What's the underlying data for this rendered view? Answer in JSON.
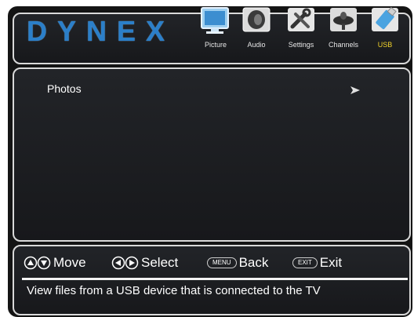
{
  "brand": "DYNEX",
  "menu": [
    {
      "label": "Picture",
      "icon": "tv-monitor-icon",
      "active": false
    },
    {
      "label": "Audio",
      "icon": "speaker-icon",
      "active": false
    },
    {
      "label": "Settings",
      "icon": "tools-icon",
      "active": false
    },
    {
      "label": "Channels",
      "icon": "satellite-dish-icon",
      "active": false
    },
    {
      "label": "USB",
      "icon": "usb-drive-icon",
      "active": true
    }
  ],
  "content": {
    "items": [
      {
        "label": "Photos",
        "icon": "arrow-right-icon"
      }
    ]
  },
  "hints": {
    "move": "Move",
    "select": "Select",
    "menu_key": "MENU",
    "back": "Back",
    "exit_key": "EXIT",
    "exit": "Exit"
  },
  "description": "View files from a USB device that is connected to the TV",
  "colors": {
    "brand": "#2b7fc9",
    "active_label": "#f0d22a",
    "panel_border": "#d9d9d9",
    "background": "#141414"
  }
}
